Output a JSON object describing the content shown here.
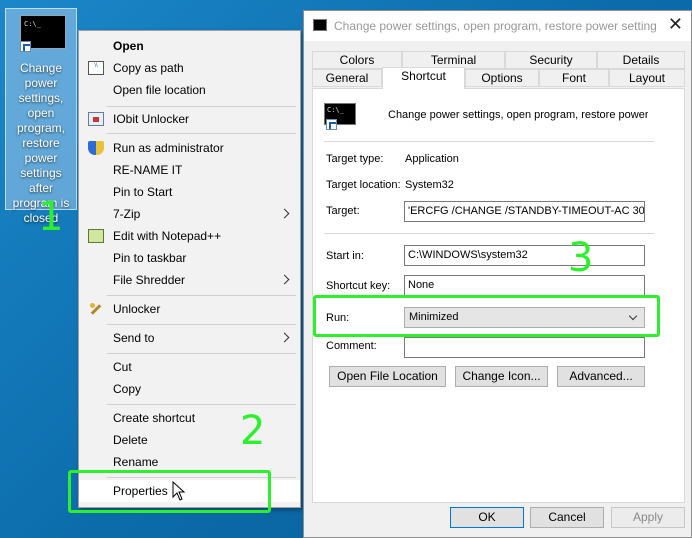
{
  "desktop": {
    "icon_label": "Change power settings, open program, restore power settings after program is closed",
    "icon_prompt": "C:\\_"
  },
  "steps": {
    "one": "1",
    "two": "2",
    "three": "3"
  },
  "context_menu": {
    "open": "Open",
    "copy_as_path": "Copy as path",
    "open_file_location": "Open file location",
    "iobit_unlocker": "IObit Unlocker",
    "run_as_admin": "Run as administrator",
    "rename_it": "RE-NAME IT",
    "pin_to_start": "Pin to Start",
    "seven_zip": "7-Zip",
    "edit_notepadpp": "Edit with Notepad++",
    "pin_to_taskbar": "Pin to taskbar",
    "file_shredder": "File Shredder",
    "unlocker": "Unlocker",
    "send_to": "Send to",
    "cut": "Cut",
    "copy": "Copy",
    "create_shortcut": "Create shortcut",
    "delete": "Delete",
    "rename": "Rename",
    "properties": "Properties",
    "path_icon_text": "\\\\"
  },
  "dialog": {
    "title": "Change power settings, open program, restore power settings after program is closed Properties",
    "close": "✕",
    "tabs_top": [
      "Colors",
      "Terminal",
      "Security",
      "Details"
    ],
    "tabs_bottom": [
      "General",
      "Shortcut",
      "Options",
      "Font",
      "Layout"
    ],
    "header_name": "Change power settings, open program, restore power settings after program is closed",
    "icon_prompt": "C:\\_",
    "target_type_label": "Target type:",
    "target_type_value": "Application",
    "target_location_label": "Target location:",
    "target_location_value": "System32",
    "target_label": "Target:",
    "target_value": "'ERCFG /CHANGE /STANDBY-TIMEOUT-AC 30",
    "start_in_label": "Start in:",
    "start_in_value": "C:\\WINDOWS\\system32",
    "shortcut_key_label": "Shortcut key:",
    "shortcut_key_value": "None",
    "run_label": "Run:",
    "run_value": "Minimized",
    "comment_label": "Comment:",
    "comment_value": "",
    "open_file_location_btn": "Open File Location",
    "change_icon_btn": "Change Icon...",
    "advanced_btn": "Advanced...",
    "ok_btn": "OK",
    "cancel_btn": "Cancel",
    "apply_btn": "Apply"
  },
  "colors": {
    "highlight": "#2df02d",
    "desktop": "#0f76b8"
  }
}
